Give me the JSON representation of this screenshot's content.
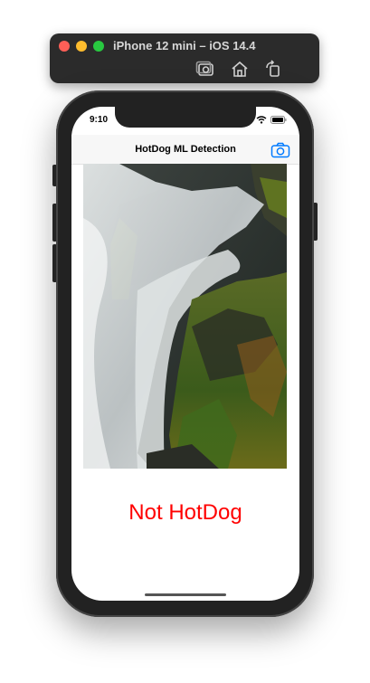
{
  "window": {
    "title": "iPhone 12 mini – iOS 14.4",
    "toolbar_icons": [
      "screenshot-icon",
      "home-icon",
      "rotate-icon"
    ]
  },
  "status_bar": {
    "time": "9:10",
    "icons": [
      "wifi-icon",
      "battery-icon"
    ]
  },
  "nav_bar": {
    "title": "HotDog ML Detection",
    "right_icon": "camera-icon"
  },
  "content": {
    "image_subject": "waterfall over mossy rocks",
    "result_text": "Not HotDog",
    "result_color": "#ff0000"
  },
  "colors": {
    "accent": "#007aff",
    "toolbar_bg": "#2b2b2b",
    "device_frame": "#222222"
  }
}
